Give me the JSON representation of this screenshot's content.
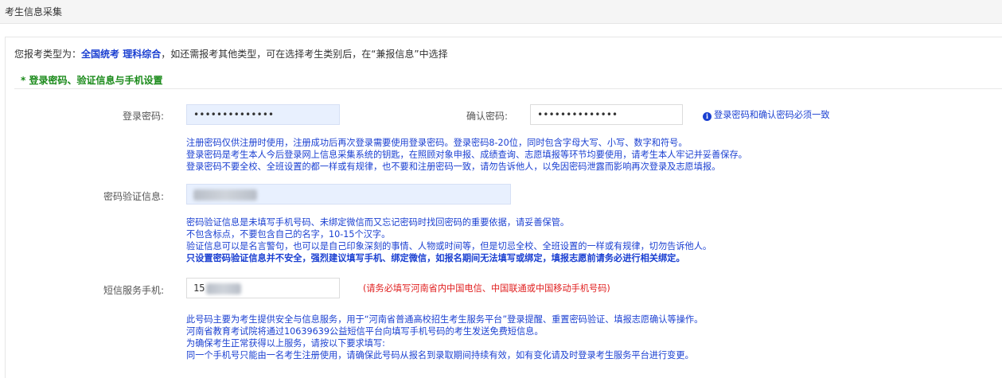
{
  "header": {
    "title": "考生信息采集"
  },
  "notice": {
    "prefix": "您报考类型为：",
    "type": "全国统考 理科综合",
    "suffix": "，如还需报考其他类型，可在选择考生类别后，在“兼报信息”中选择"
  },
  "section": {
    "title": "* 登录密码、验证信息与手机设置"
  },
  "login_password": {
    "label": "登录密码:",
    "value": "••••••••••••••"
  },
  "confirm_password": {
    "label": "确认密码:",
    "value": "••••••••••••••"
  },
  "password_tip": {
    "icon": "info-icon",
    "text": "登录密码和确认密码必须一致"
  },
  "password_hints": [
    "注册密码仅供注册时使用，注册成功后再次登录需要使用登录密码。登录密码8-20位，同时包含字母大写、小写、数字和符号。",
    "登录密码是考生本人今后登录网上信息采集系统的钥匙，在照顾对象申报、成绩查询、志愿填报等环节均要使用，请考生本人牢记并妥善保存。",
    "登录密码不要全校、全班设置的都一样或有规律，也不要和注册密码一致，请勿告诉他人，以免因密码泄露而影响再次登录及志愿填报。"
  ],
  "verify_info": {
    "label": "密码验证信息:",
    "value": ""
  },
  "verify_hints": [
    "密码验证信息是未填写手机号码、未绑定微信而又忘记密码时找回密码的重要依据，请妥善保管。",
    "不包含标点，不要包含自己的名字，10-15个汉字。",
    "验证信息可以是名言警句，也可以是自己印象深刻的事情、人物或时间等，但是切忌全校、全班设置的一样或有规律，切勿告诉他人。",
    "只设置密码验证信息并不安全，强烈建议填写手机、绑定微信，如报名期间无法填写或绑定，填报志愿前请务必进行相关绑定。"
  ],
  "phone": {
    "label": "短信服务手机:",
    "value": "15",
    "warn": "(请务必填写河南省内中国电信、中国联通或中国移动手机号码)"
  },
  "phone_hints": [
    "此号码主要为考生提供安全与信息服务，用于“河南省普通高校招生考生服务平台”登录提醒、重置密码验证、填报志愿确认等操作。",
    "河南省教育考试院将通过10639639公益短信平台向填写手机号码的考生发送免费短信息。",
    "为确保考生正常获得以上服务，请按以下要求填写:",
    "同一个手机号只能由一名考生注册使用，请确保此号码从报名到录取期间持续有效，如有变化请及时登录考生服务平台进行变更。"
  ],
  "colors": {
    "accent": "#1a3fd1",
    "section": "#1a8a1a",
    "warn": "#e02020",
    "filled_input": "#e8f0fe"
  }
}
